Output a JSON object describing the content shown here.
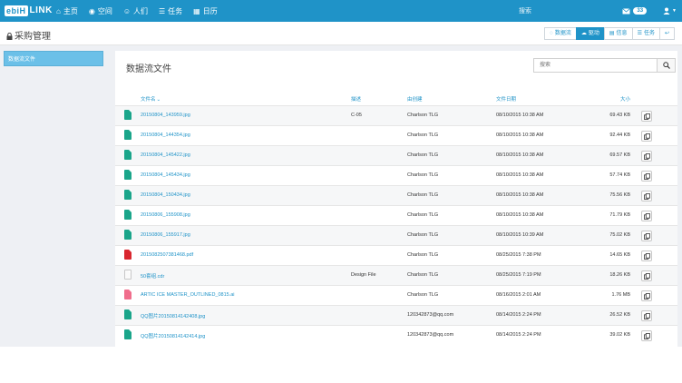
{
  "topbar": {
    "logo_box": "ebiH",
    "logo_text": "LINK",
    "nav": [
      {
        "icon": "home-icon",
        "glyph": "⌂",
        "label": "主页"
      },
      {
        "icon": "chat-icon",
        "glyph": "◉",
        "label": "空间"
      },
      {
        "icon": "people-icon",
        "glyph": "☺",
        "label": "人们"
      },
      {
        "icon": "tasks-icon",
        "glyph": "☰",
        "label": "任务"
      },
      {
        "icon": "calendar-icon",
        "glyph": "▦",
        "label": "日历"
      }
    ],
    "search_label": "搜索",
    "mail_count": "33",
    "accent_color": "#1f93c8"
  },
  "subheader": {
    "title": "采购管理",
    "tabs": [
      {
        "label": "数据流",
        "active": false
      },
      {
        "label": "驱动",
        "active": true
      },
      {
        "label": "信息",
        "active": false
      },
      {
        "label": "任务",
        "active": false
      },
      {
        "label": "",
        "active": false
      }
    ]
  },
  "sidebar": {
    "items": [
      {
        "label": "数据流文件"
      }
    ]
  },
  "main": {
    "title": "数据流文件",
    "search_placeholder": "搜索",
    "columns": {
      "name": "文件名",
      "desc": "描述",
      "creator": "由创建",
      "date": "文件日期",
      "size": "大小"
    },
    "rows": [
      {
        "type": "jpg",
        "name": "20150804_143959.jpg",
        "desc": "C-05",
        "creator": "Charlson TLG",
        "date": "08/10/2015 10:38 AM",
        "size": "69.43 KB"
      },
      {
        "type": "jpg",
        "name": "20150804_144354.jpg",
        "desc": "",
        "creator": "Charlson TLG",
        "date": "08/10/2015 10:38 AM",
        "size": "92.44 KB"
      },
      {
        "type": "jpg",
        "name": "20150804_145422.jpg",
        "desc": "",
        "creator": "Charlson TLG",
        "date": "08/10/2015 10:38 AM",
        "size": "69.57 KB"
      },
      {
        "type": "jpg",
        "name": "20150804_145434.jpg",
        "desc": "",
        "creator": "Charlson TLG",
        "date": "08/10/2015 10:38 AM",
        "size": "57.74 KB"
      },
      {
        "type": "jpg",
        "name": "20150804_150434.jpg",
        "desc": "",
        "creator": "Charlson TLG",
        "date": "08/10/2015 10:38 AM",
        "size": "75.56 KB"
      },
      {
        "type": "jpg",
        "name": "20150806_155908.jpg",
        "desc": "",
        "creator": "Charlson TLG",
        "date": "08/10/2015 10:38 AM",
        "size": "71.79 KB"
      },
      {
        "type": "jpg",
        "name": "20150806_155917.jpg",
        "desc": "",
        "creator": "Charlson TLG",
        "date": "08/10/2015 10:39 AM",
        "size": "75.02 KB"
      },
      {
        "type": "pdf",
        "name": "2015082507381468.pdf",
        "desc": "",
        "creator": "Charlson TLG",
        "date": "08/25/2015 7:38 PM",
        "size": "14.65 KB"
      },
      {
        "type": "cdr",
        "name": "50套组.cdr",
        "desc": "Design File",
        "creator": "Charlson TLG",
        "date": "08/25/2015 7:19 PM",
        "size": "18.26 KB"
      },
      {
        "type": "ai",
        "name": "ARTIC ICE MASTER_OUTLINED_0815.ai",
        "desc": "",
        "creator": "Charlson TLG",
        "date": "08/16/2015 2:01 AM",
        "size": "1.76 MB"
      },
      {
        "type": "jpg",
        "name": "QQ图片20150814142408.jpg",
        "desc": "",
        "creator": "120342873@qq.com",
        "date": "08/14/2015 2:24 PM",
        "size": "26.52 KB"
      },
      {
        "type": "jpg",
        "name": "QQ图片20150814142414.jpg",
        "desc": "",
        "creator": "120342873@qq.com",
        "date": "08/14/2015 2:24 PM",
        "size": "39.02 KB"
      }
    ]
  }
}
